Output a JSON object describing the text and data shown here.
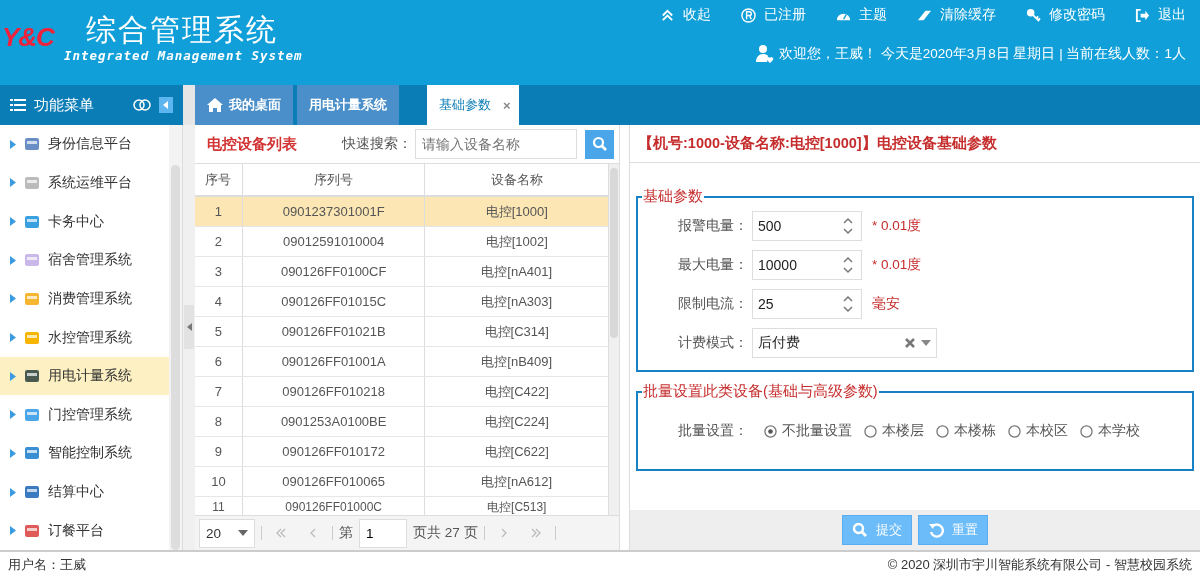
{
  "header": {
    "logo": "Y&C",
    "title": "综合管理系统",
    "subtitle": "Integrated Management System",
    "links": [
      {
        "label": "收起"
      },
      {
        "label": "已注册"
      },
      {
        "label": "主题"
      },
      {
        "label": "清除缓存"
      },
      {
        "label": "修改密码"
      },
      {
        "label": "退出"
      }
    ],
    "welcome": "欢迎您，王威！ 今天是2020年3月8日 星期日 | 当前在线人数：1人"
  },
  "sidebar": {
    "title": "功能菜单",
    "items": [
      {
        "label": "身份信息平台",
        "selected": false
      },
      {
        "label": "系统运维平台",
        "selected": false
      },
      {
        "label": "卡务中心",
        "selected": false
      },
      {
        "label": "宿舍管理系统",
        "selected": false
      },
      {
        "label": "消费管理系统",
        "selected": false
      },
      {
        "label": "水控管理系统",
        "selected": false
      },
      {
        "label": "用电计量系统",
        "selected": true
      },
      {
        "label": "门控管理系统",
        "selected": false
      },
      {
        "label": "智能控制系统",
        "selected": false
      },
      {
        "label": "结算中心",
        "selected": false
      },
      {
        "label": "订餐平台",
        "selected": false
      }
    ]
  },
  "tabs": [
    {
      "kind": "home",
      "label": "我的桌面",
      "selected": false
    },
    {
      "kind": "plain",
      "label": "用电计量系统",
      "selected": false
    },
    {
      "kind": "plain",
      "label": "基础参数",
      "close": "×",
      "selected": true
    }
  ],
  "device_list": {
    "title": "电控设备列表",
    "search_label": "快速搜索：",
    "search_placeholder": "请输入设备名称",
    "columns": [
      "序号",
      "序列号",
      "设备名称"
    ],
    "rows": [
      {
        "cells": [
          "1",
          "0901237301001F",
          "电控[1000]"
        ],
        "selected": true
      },
      {
        "cells": [
          "2",
          "09012591010004",
          "电控[1002]"
        ],
        "selected": false
      },
      {
        "cells": [
          "3",
          "090126FF0100CF",
          "电控[nA401]"
        ],
        "selected": false
      },
      {
        "cells": [
          "4",
          "090126FF01015C",
          "电控[nA303]"
        ],
        "selected": false
      },
      {
        "cells": [
          "5",
          "090126FF01021B",
          "电控[C314]"
        ],
        "selected": false
      },
      {
        "cells": [
          "6",
          "090126FF01001A",
          "电控[nB409]"
        ],
        "selected": false
      },
      {
        "cells": [
          "7",
          "090126FF010218",
          "电控[C422]"
        ],
        "selected": false
      },
      {
        "cells": [
          "8",
          "0901253A0100BE",
          "电控[C224]"
        ],
        "selected": false
      },
      {
        "cells": [
          "9",
          "090126FF010172",
          "电控[C622]"
        ],
        "selected": false
      },
      {
        "cells": [
          "10",
          "090126FF010065",
          "电控[nA612]"
        ],
        "selected": false
      },
      {
        "cells": [
          "11",
          "090126FF01000C",
          "电控[C513]"
        ],
        "selected": false
      }
    ],
    "pager": {
      "page_size": "20",
      "page_prefix": "第",
      "page": "1",
      "page_suffix": "页共 27 页"
    }
  },
  "detail": {
    "title": "【机号:1000-设备名称:电控[1000]】电控设备基础参数",
    "basic": {
      "legend": "基础参数",
      "fields": [
        {
          "kind": "spinner",
          "label": "报警电量：",
          "value": "500",
          "unit": "* 0.01度"
        },
        {
          "kind": "spinner",
          "label": "最大电量：",
          "value": "10000",
          "unit": "* 0.01度"
        },
        {
          "kind": "spinner",
          "label": "限制电流：",
          "value": "25",
          "unit": "毫安"
        },
        {
          "kind": "select",
          "label": "计费模式：",
          "value": "后付费"
        }
      ]
    },
    "batch": {
      "legend": "批量设置此类设备(基础与高级参数)",
      "label": "批量设置：",
      "options": [
        {
          "label": "不批量设置",
          "selected": true
        },
        {
          "label": "本楼层",
          "selected": false
        },
        {
          "label": "本楼栋",
          "selected": false
        },
        {
          "label": "本校区",
          "selected": false
        },
        {
          "label": "本学校",
          "selected": false
        }
      ]
    },
    "buttons": [
      {
        "label": "提交"
      },
      {
        "label": "重置"
      }
    ]
  },
  "footer": {
    "user": "用户名：王威",
    "copyright": "© 2020 深圳市宇川智能系统有限公司 - 智慧校园系统"
  }
}
